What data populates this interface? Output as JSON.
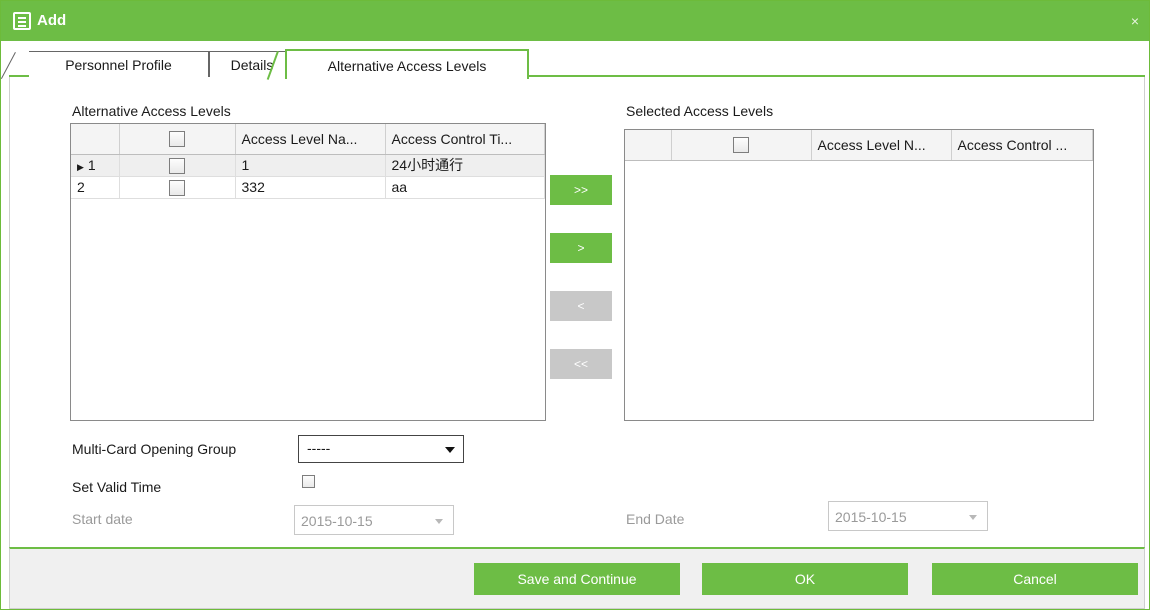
{
  "window": {
    "title": "Add",
    "close": "×"
  },
  "tabs": [
    {
      "label": "Personnel Profile"
    },
    {
      "label": "Details"
    },
    {
      "label": "Alternative Access Levels"
    }
  ],
  "left_panel": {
    "title": "Alternative Access Levels",
    "columns": [
      "",
      "",
      "Access Level Na...",
      "Access Control Ti..."
    ],
    "rows": [
      {
        "index": "1",
        "current": true,
        "name": "1",
        "time": "24小时通行"
      },
      {
        "index": "2",
        "current": false,
        "name": "332",
        "time": "aa"
      }
    ]
  },
  "right_panel": {
    "title": "Selected Access Levels",
    "columns": [
      "",
      "",
      "Access Level N...",
      "Access Control ..."
    ],
    "rows": []
  },
  "move_buttons": {
    "add_all": ">>",
    "add": ">",
    "remove": "<",
    "remove_all": "<<"
  },
  "form": {
    "multicard_label": "Multi-Card Opening Group",
    "multicard_value": "-----",
    "valid_time_label": "Set Valid Time",
    "start_label": "Start date",
    "start_value": "2015-10-15",
    "end_label": "End Date",
    "end_value": "2015-10-15"
  },
  "footer": {
    "save_continue": "Save and Continue",
    "ok": "OK",
    "cancel": "Cancel"
  },
  "colors": {
    "accent": "#6dbd45",
    "disabled": "#c8c8c8"
  }
}
